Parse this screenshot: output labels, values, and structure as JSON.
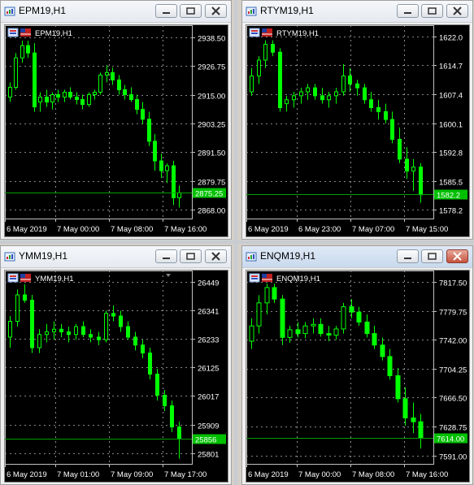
{
  "windows": [
    {
      "title": "EPM19,H1",
      "symbol_label": "EPM19,H1",
      "active": false,
      "close_red": false,
      "chart_data": {
        "type": "candlestick",
        "y_ticks": [
          "2938.50",
          "2926.75",
          "2915.00",
          "2903.25",
          "2891.50",
          "2879.75",
          "2868.00"
        ],
        "y_tick_values": [
          2938.5,
          2926.75,
          2915.0,
          2903.25,
          2891.5,
          2879.75,
          2868.0
        ],
        "x_ticks": [
          "6 May 2019",
          "7 May 00:00",
          "7 May 08:00",
          "7 May 16:00"
        ],
        "last_price": "2875.25",
        "last_value": 2875.25,
        "ylim": [
          2864.5,
          2942.0
        ],
        "candles": [
          [
            2914,
            2920,
            2912,
            2918
          ],
          [
            2918,
            2932,
            2917,
            2930
          ],
          [
            2930,
            2937,
            2928,
            2935
          ],
          [
            2935,
            2937,
            2930,
            2932
          ],
          [
            2932,
            2936,
            2908,
            2910
          ],
          [
            2912,
            2916,
            2908,
            2914
          ],
          [
            2914,
            2917,
            2910,
            2912
          ],
          [
            2912,
            2916,
            2909,
            2915
          ],
          [
            2915,
            2917,
            2912,
            2914
          ],
          [
            2914,
            2917,
            2912,
            2916
          ],
          [
            2916,
            2918,
            2913,
            2914
          ],
          [
            2914,
            2916,
            2911,
            2913
          ],
          [
            2913,
            2915,
            2909,
            2911
          ],
          [
            2911,
            2916,
            2910,
            2915
          ],
          [
            2915,
            2917,
            2913,
            2916
          ],
          [
            2916,
            2924,
            2915,
            2923
          ],
          [
            2923,
            2927,
            2920,
            2924
          ],
          [
            2924,
            2926,
            2919,
            2921
          ],
          [
            2921,
            2923,
            2915,
            2917
          ],
          [
            2917,
            2919,
            2913,
            2915
          ],
          [
            2915,
            2918,
            2912,
            2913
          ],
          [
            2913,
            2915,
            2907,
            2909
          ],
          [
            2909,
            2912,
            2903,
            2905
          ],
          [
            2905,
            2908,
            2894,
            2896
          ],
          [
            2896,
            2899,
            2884,
            2888
          ],
          [
            2888,
            2891,
            2881,
            2884
          ],
          [
            2884,
            2887,
            2879,
            2886
          ],
          [
            2886,
            2888,
            2870,
            2873
          ],
          [
            2873,
            2878,
            2869,
            2875
          ]
        ]
      }
    },
    {
      "title": "RTYM19,H1",
      "symbol_label": "RTYM19,H1",
      "active": false,
      "close_red": false,
      "chart_data": {
        "type": "candlestick",
        "y_ticks": [
          "1622.0",
          "1614.7",
          "1607.4",
          "1600.1",
          "1592.8",
          "1585.5",
          "1578.2"
        ],
        "y_tick_values": [
          1622.0,
          1614.7,
          1607.4,
          1600.1,
          1592.8,
          1585.5,
          1578.2
        ],
        "x_ticks": [
          "6 May 2019",
          "6 May 23:00",
          "7 May 07:00",
          "7 May 15:00"
        ],
        "last_price": "1582.2",
        "last_value": 1582.2,
        "ylim": [
          1576.0,
          1624.0
        ],
        "candles": [
          [
            1608,
            1614,
            1607,
            1612
          ],
          [
            1612,
            1617,
            1610,
            1616
          ],
          [
            1616,
            1621,
            1614,
            1620
          ],
          [
            1620,
            1621,
            1617,
            1618
          ],
          [
            1618,
            1619,
            1603,
            1604
          ],
          [
            1605,
            1607,
            1603,
            1606
          ],
          [
            1606,
            1608,
            1604,
            1607
          ],
          [
            1607,
            1609,
            1605,
            1608
          ],
          [
            1608,
            1610,
            1606,
            1609
          ],
          [
            1609,
            1610,
            1606,
            1607
          ],
          [
            1607,
            1609,
            1605,
            1606
          ],
          [
            1606,
            1608,
            1604,
            1607
          ],
          [
            1607,
            1609,
            1605,
            1608
          ],
          [
            1608,
            1615,
            1607,
            1612
          ],
          [
            1612,
            1614,
            1608,
            1610
          ],
          [
            1610,
            1611,
            1607,
            1609
          ],
          [
            1609,
            1610,
            1605,
            1606
          ],
          [
            1606,
            1608,
            1603,
            1604
          ],
          [
            1604,
            1606,
            1601,
            1603
          ],
          [
            1603,
            1605,
            1600,
            1601
          ],
          [
            1601,
            1603,
            1595,
            1596
          ],
          [
            1596,
            1599,
            1590,
            1591
          ],
          [
            1591,
            1594,
            1586,
            1588
          ],
          [
            1588,
            1591,
            1583,
            1589
          ],
          [
            1589,
            1590,
            1580,
            1582
          ]
        ]
      }
    },
    {
      "title": "YMM19,H1",
      "symbol_label": "YMM19,H1",
      "active": false,
      "close_red": false,
      "chart_data": {
        "type": "candlestick",
        "y_ticks": [
          "26449",
          "26341",
          "26233",
          "26125",
          "26017",
          "25909",
          "25801"
        ],
        "y_tick_values": [
          26449,
          26341,
          26233,
          26125,
          26017,
          25909,
          25801
        ],
        "x_ticks": [
          "6 May 2019",
          "7 May 01:00",
          "7 May 09:00",
          "7 May 17:00"
        ],
        "last_price": "25856",
        "last_value": 25856,
        "ylim": [
          25760,
          26480
        ],
        "candles": [
          [
            26240,
            26320,
            26200,
            26300
          ],
          [
            26300,
            26420,
            26280,
            26400
          ],
          [
            26400,
            26440,
            26370,
            26380
          ],
          [
            26380,
            26400,
            26180,
            26200
          ],
          [
            26200,
            26270,
            26180,
            26250
          ],
          [
            26250,
            26290,
            26220,
            26260
          ],
          [
            26260,
            26300,
            26230,
            26270
          ],
          [
            26270,
            26290,
            26240,
            26260
          ],
          [
            26260,
            26280,
            26220,
            26250
          ],
          [
            26250,
            26290,
            26230,
            26280
          ],
          [
            26280,
            26300,
            26240,
            26250
          ],
          [
            26250,
            26270,
            26220,
            26240
          ],
          [
            26240,
            26260,
            26210,
            26230
          ],
          [
            26230,
            26340,
            26220,
            26330
          ],
          [
            26330,
            26360,
            26300,
            26320
          ],
          [
            26320,
            26340,
            26260,
            26280
          ],
          [
            26280,
            26300,
            26230,
            26240
          ],
          [
            26240,
            26260,
            26190,
            26210
          ],
          [
            26210,
            26230,
            26160,
            26180
          ],
          [
            26180,
            26200,
            26080,
            26100
          ],
          [
            26100,
            26120,
            26000,
            26020
          ],
          [
            26020,
            26040,
            25960,
            25980
          ],
          [
            25980,
            26000,
            25880,
            25900
          ],
          [
            25900,
            25920,
            25780,
            25856
          ]
        ]
      }
    },
    {
      "title": "ENQM19,H1",
      "symbol_label": "ENQM19,H1",
      "active": true,
      "close_red": true,
      "chart_data": {
        "type": "candlestick",
        "y_ticks": [
          "7817.50",
          "7779.75",
          "7742.00",
          "7704.25",
          "7666.50",
          "7628.75",
          "7591.00"
        ],
        "y_tick_values": [
          7817.5,
          7779.75,
          7742.0,
          7704.25,
          7666.5,
          7628.75,
          7591.0
        ],
        "x_ticks": [
          "6 May 2019",
          "7 May 00:00",
          "7 May 08:00",
          "7 May 16:00"
        ],
        "last_price": "7614.00",
        "last_value": 7614.0,
        "ylim": [
          7580.0,
          7828.0
        ],
        "candles": [
          [
            7740,
            7770,
            7730,
            7760
          ],
          [
            7760,
            7800,
            7750,
            7790
          ],
          [
            7790,
            7815,
            7775,
            7810
          ],
          [
            7810,
            7815,
            7790,
            7795
          ],
          [
            7795,
            7800,
            7735,
            7745
          ],
          [
            7745,
            7760,
            7738,
            7755
          ],
          [
            7755,
            7765,
            7745,
            7750
          ],
          [
            7750,
            7765,
            7744,
            7760
          ],
          [
            7760,
            7770,
            7750,
            7762
          ],
          [
            7762,
            7770,
            7746,
            7750
          ],
          [
            7750,
            7760,
            7740,
            7748
          ],
          [
            7748,
            7760,
            7742,
            7756
          ],
          [
            7756,
            7790,
            7750,
            7785
          ],
          [
            7785,
            7795,
            7770,
            7778
          ],
          [
            7778,
            7785,
            7760,
            7765
          ],
          [
            7765,
            7775,
            7745,
            7750
          ],
          [
            7750,
            7760,
            7730,
            7735
          ],
          [
            7735,
            7745,
            7715,
            7720
          ],
          [
            7720,
            7730,
            7690,
            7695
          ],
          [
            7695,
            7705,
            7660,
            7665
          ],
          [
            7665,
            7680,
            7630,
            7640
          ],
          [
            7640,
            7660,
            7620,
            7635
          ],
          [
            7635,
            7645,
            7600,
            7614
          ]
        ]
      }
    }
  ],
  "colors": {
    "bull": "#00ff00",
    "bear": "#000000",
    "wick": "#00ff00",
    "grid": "#b0b0b0",
    "axis_text": "#ffffff",
    "last_price_bg": "#00c000",
    "last_price_line": "#00a000",
    "chart_bg": "#000000"
  },
  "icons": {
    "window_icon": "chart-window-icon",
    "minimize": "minimize-icon",
    "restore": "restore-icon",
    "close": "close-icon",
    "flag": "flag-icon"
  }
}
